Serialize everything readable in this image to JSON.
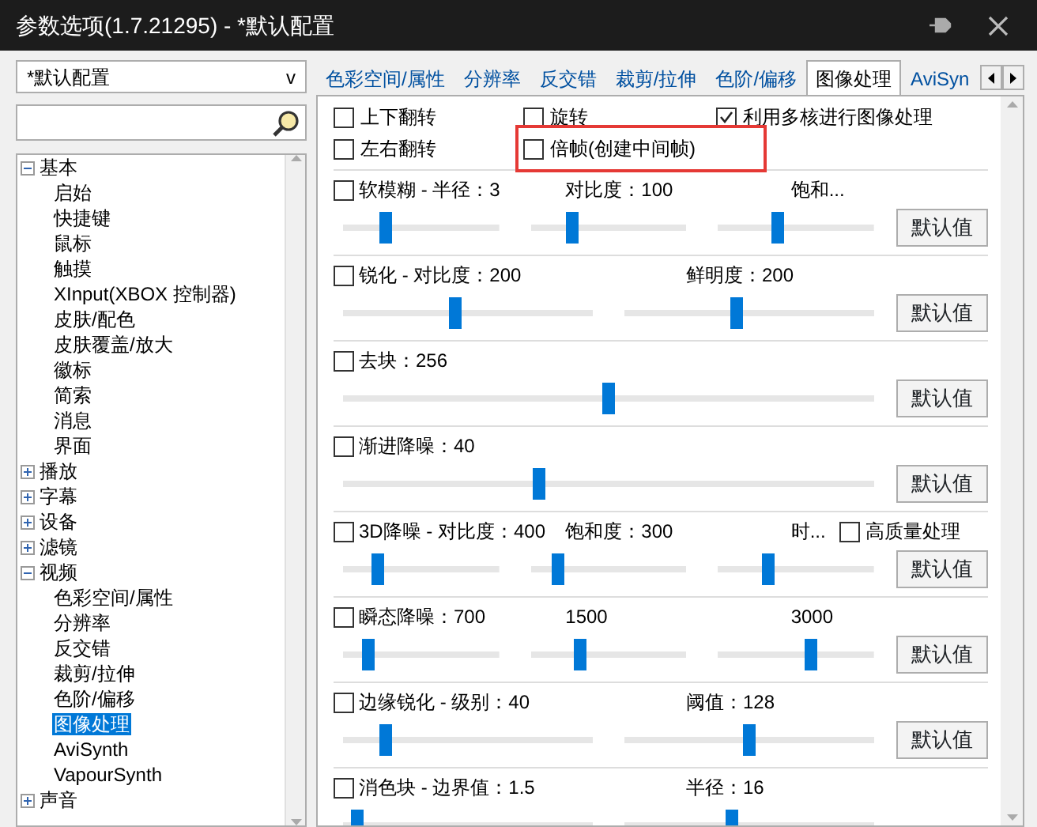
{
  "window": {
    "title": "参数选项(1.7.21295) - *默认配置"
  },
  "profile_select": {
    "value": "*默认配置",
    "caret": "v"
  },
  "tree": [
    {
      "label": "基本",
      "expanded": true,
      "selected": false,
      "children": [
        {
          "label": "启始",
          "selected": false
        },
        {
          "label": "快捷键",
          "selected": false
        },
        {
          "label": "鼠标",
          "selected": false
        },
        {
          "label": "触摸",
          "selected": false
        },
        {
          "label": "XInput(XBOX 控制器)",
          "selected": false
        },
        {
          "label": "皮肤/配色",
          "selected": false
        },
        {
          "label": "皮肤覆盖/放大",
          "selected": false
        },
        {
          "label": "徽标",
          "selected": false
        },
        {
          "label": "简索",
          "selected": false
        },
        {
          "label": "消息",
          "selected": false
        },
        {
          "label": "界面",
          "selected": false
        }
      ]
    },
    {
      "label": "播放",
      "expanded": false,
      "selected": false
    },
    {
      "label": "字幕",
      "expanded": false,
      "selected": false
    },
    {
      "label": "设备",
      "expanded": false,
      "selected": false
    },
    {
      "label": "滤镜",
      "expanded": false,
      "selected": false
    },
    {
      "label": "视频",
      "expanded": true,
      "selected": false,
      "children": [
        {
          "label": "色彩空间/属性",
          "selected": false
        },
        {
          "label": "分辨率",
          "selected": false
        },
        {
          "label": "反交错",
          "selected": false
        },
        {
          "label": "裁剪/拉伸",
          "selected": false
        },
        {
          "label": "色阶/偏移",
          "selected": false
        },
        {
          "label": "图像处理",
          "selected": true
        },
        {
          "label": "AviSynth",
          "selected": false
        },
        {
          "label": "VapourSynth",
          "selected": false
        }
      ]
    },
    {
      "label": "声音",
      "expanded": false,
      "selected": false
    }
  ],
  "tabs": [
    {
      "label": "色彩空间/属性",
      "selected": false
    },
    {
      "label": "分辨率",
      "selected": false
    },
    {
      "label": "反交错",
      "selected": false
    },
    {
      "label": "裁剪/拉伸",
      "selected": false
    },
    {
      "label": "色阶/偏移",
      "selected": false
    },
    {
      "label": "图像处理",
      "selected": true
    },
    {
      "label": "AviSyn",
      "selected": false
    }
  ],
  "top_options": [
    [
      {
        "label": "上下翻转",
        "checked": false,
        "highlighted": false
      },
      {
        "label": "旋转",
        "checked": false,
        "highlighted": false
      },
      {
        "label": "利用多核进行图像处理",
        "checked": true,
        "highlighted": false
      }
    ],
    [
      {
        "label": "左右翻转",
        "checked": false,
        "highlighted": false
      },
      {
        "label": "倍帧(创建中间帧)",
        "checked": false,
        "highlighted": true
      }
    ]
  ],
  "sections": [
    {
      "checked": false,
      "labels": [
        "软模糊 - 半径：3",
        "对比度：100",
        "饱和..."
      ],
      "sliders": [
        {
          "level": 0.27
        },
        {
          "level": 0.27
        },
        {
          "level": 0.38
        }
      ],
      "button": "默认值"
    },
    {
      "checked": false,
      "labels": [
        "锐化 - 对比度：200",
        "鲜明度：200"
      ],
      "sliders": [
        {
          "level": 0.45
        },
        {
          "level": 0.45
        }
      ],
      "button": "默认值"
    },
    {
      "checked": false,
      "labels": [
        "去块：256"
      ],
      "sliders": [
        {
          "level": 0.5
        }
      ],
      "button": "默认值"
    },
    {
      "checked": false,
      "labels": [
        "渐进降噪：40"
      ],
      "sliders": [
        {
          "level": 0.37
        }
      ],
      "button": "默认值"
    },
    {
      "checked": false,
      "labels": [
        "3D降噪 - 对比度：400",
        "饱和度：300",
        "时..."
      ],
      "extra_option": {
        "label": "高质量处理",
        "checked": false
      },
      "sliders": [
        {
          "level": 0.22
        },
        {
          "level": 0.18
        },
        {
          "level": 0.32
        }
      ],
      "button": "默认值"
    },
    {
      "checked": false,
      "labels": [
        "瞬态降噪：700",
        "1500",
        "3000"
      ],
      "sliders": [
        {
          "level": 0.16
        },
        {
          "level": 0.32
        },
        {
          "level": 0.59
        }
      ],
      "button": "默认值"
    },
    {
      "checked": false,
      "labels": [
        "边缘锐化 - 级别：40",
        "阈值：128"
      ],
      "sliders": [
        {
          "level": 0.17
        },
        {
          "level": 0.5
        }
      ],
      "button": "默认值"
    },
    {
      "checked": false,
      "labels": [
        "消色块 - 边界值：1.5",
        "半径：16"
      ],
      "sliders": [
        {
          "level": 0.06
        },
        {
          "level": 0.43
        }
      ]
    }
  ]
}
